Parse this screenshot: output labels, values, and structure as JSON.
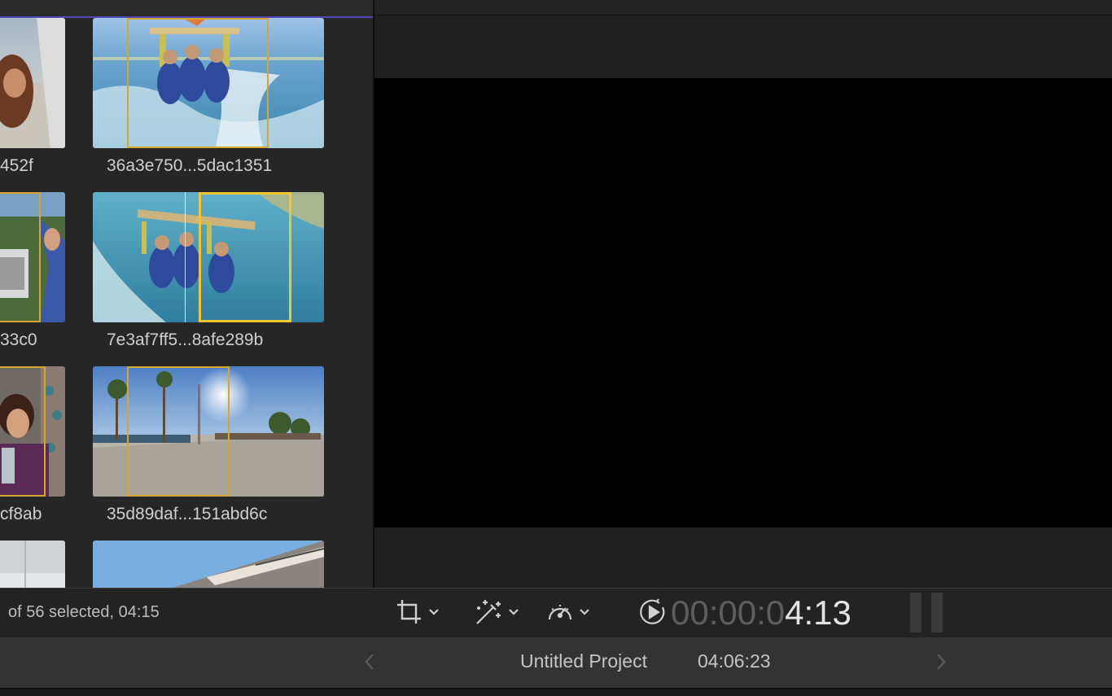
{
  "browser": {
    "clips": [
      {
        "label": "452f"
      },
      {
        "label": "36a3e750...5dac1351"
      },
      {
        "label": "33c0"
      },
      {
        "label": "7e3af7ff5...8afe289b"
      },
      {
        "label": "cf8ab"
      },
      {
        "label": "35d89daf...151abd6c"
      }
    ],
    "status": "of 56 selected, 04:15"
  },
  "viewer": {
    "timecode_dim": "00:00:0",
    "timecode_lit": "4:13"
  },
  "timeline": {
    "project_name": "Untitled Project",
    "project_duration": "04:06:23"
  },
  "colors": {
    "range_selection": "#d6a62e",
    "range_selection_active": "#f0c530",
    "browser_accent": "#4f47b8"
  },
  "icons": [
    "crop-icon",
    "magic-wand-icon",
    "speedometer-icon",
    "play-circle-icon",
    "chevron-left-icon",
    "chevron-right-icon"
  ]
}
